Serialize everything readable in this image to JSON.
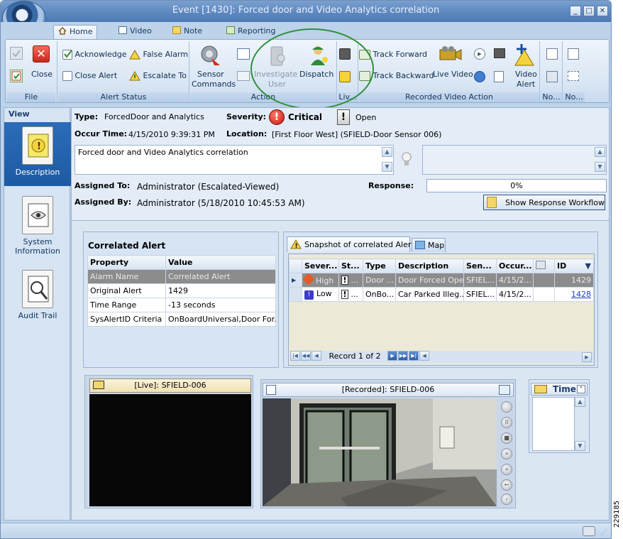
{
  "window": {
    "title": "Event [1430]: Forced door and Video Analytics correlation",
    "controls": [
      "_",
      "□",
      "✕"
    ]
  },
  "tabs": [
    {
      "label": "Home",
      "icon": "home-icon"
    },
    {
      "label": "Video",
      "icon": "video-icon"
    },
    {
      "label": "Note",
      "icon": "note-icon"
    },
    {
      "label": "Reporting",
      "icon": "reporting-icon"
    }
  ],
  "ribbon": {
    "file": {
      "label": "File",
      "close": "Close"
    },
    "alert_status": {
      "label": "Alert Status",
      "acknowledge": "Acknowledge",
      "false_alarm": "False Alarm",
      "close_alert": "Close Alert",
      "escalate_to": "Escalate To"
    },
    "action": {
      "label": "Action",
      "sensor_commands_1": "Sensor",
      "sensor_commands_2": "Commands",
      "investigate_1": "Investigate",
      "investigate_2": "User",
      "dispatch": "Dispatch"
    },
    "live": {
      "label": "Liv..."
    },
    "recorded": {
      "label": "Recorded Video Action",
      "track_forward": "Track Forward",
      "track_backward": "Track Backward",
      "live_video": "Live Video",
      "video_alert_1": "Video",
      "video_alert_2": "Alert"
    },
    "no1": {
      "label": "No..."
    },
    "no2": {
      "label": "No..."
    }
  },
  "nav": {
    "header": "View",
    "items": [
      {
        "label": "Description",
        "icon": "description-icon"
      },
      {
        "label1": "System",
        "label2": "Information",
        "icon": "system-information-icon"
      },
      {
        "label": "Audit Trail",
        "icon": "audit-trail-icon"
      }
    ]
  },
  "event": {
    "type_label": "Type:",
    "type_value": "ForcedDoor and Analytics",
    "severity_label": "Severity:",
    "severity_value": "Critical",
    "status_value": "Open",
    "occur_label": "Occur Time:",
    "occur_value": "4/15/2010 9:39:31 PM",
    "location_label": "Location:",
    "location_value": "[First Floor West] (SFIELD-Door Sensor 006)",
    "description": "Forced door and Video Analytics correlation",
    "assigned_to_label": "Assigned To:",
    "assigned_to_value": "Administrator (Escalated-Viewed)",
    "response_label": "Response:",
    "response_value": "0%",
    "response_progress": 0,
    "assigned_by_label": "Assigned By:",
    "assigned_by_value": "Administrator (5/18/2010 10:45:53 AM)",
    "workflow_button": "Show Response Workflow"
  },
  "correlated": {
    "title": "Correlated Alert",
    "headers": [
      "Property",
      "Value"
    ],
    "rows": [
      [
        "Alarm Name",
        "Correlated Alert"
      ],
      [
        "Original Alert",
        "1429"
      ],
      [
        "Time Range",
        "-13 seconds"
      ],
      [
        "SysAlertID Criteria",
        "OnBoardUniversal,Door For..."
      ]
    ]
  },
  "snapshot": {
    "tab_snapshot": "Snapshot of correlated Alerts",
    "tab_map": "Map",
    "headers": [
      "Sever...",
      "St...",
      "Type",
      "Description",
      "Sen...",
      "Occur...",
      "",
      "ID"
    ],
    "rows": [
      [
        "High",
        "...",
        "Door ...",
        "Door Forced Open",
        "SFIEL...",
        "4/15/2...",
        "",
        "1429"
      ],
      [
        "Low",
        "...",
        "OnBo...",
        "Car Parked Illeg...",
        "SFIEL...",
        "4/15/2...",
        "",
        "1428"
      ]
    ],
    "record_text": "Record 1 of 2"
  },
  "video": {
    "live_title": "[Live]: SFIELD-006",
    "recorded_title": "[Recorded]: SFIELD-006"
  },
  "time_panel": {
    "title": "Time"
  },
  "side_number": "229185"
}
